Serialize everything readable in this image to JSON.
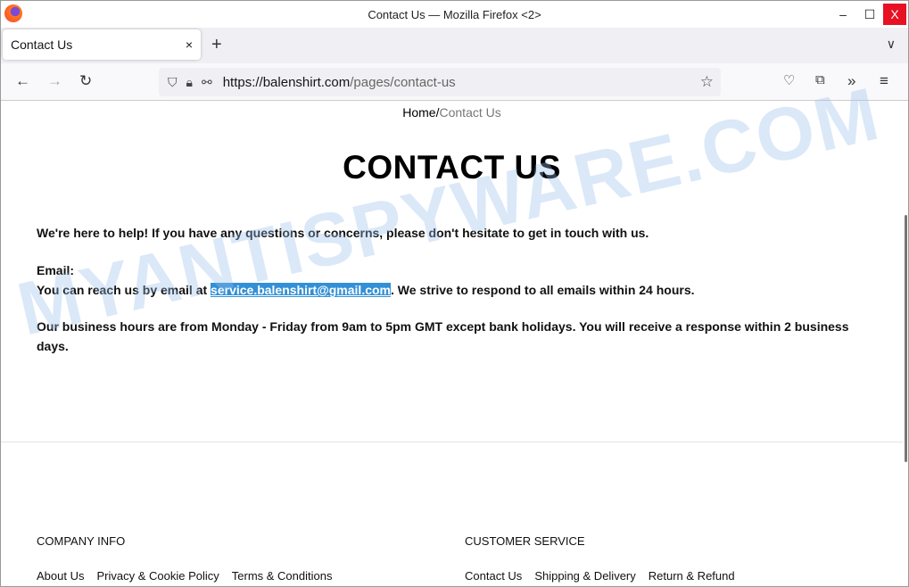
{
  "window": {
    "title": "Contact Us — Mozilla Firefox <2>",
    "minimize": "–",
    "maximize": "☐",
    "close": "X"
  },
  "tab": {
    "label": "Contact Us",
    "close": "×",
    "new_tab": "+",
    "list": "∨"
  },
  "nav": {
    "url_host": "https://balenshirt.com",
    "url_path": "/pages/contact-us"
  },
  "breadcrumb": {
    "home": "Home",
    "sep": "/",
    "current": "Contact Us"
  },
  "page": {
    "title": "CONTACT US",
    "intro": "We're here to help! If you have any questions or concerns, please don't hesitate to get in touch with us.",
    "email_label": "Email:",
    "email_pre": "You can reach us by email at ",
    "email": "service.balenshirt@gmail.com",
    "email_post": ". We strive to respond to all emails within 24 hours.",
    "hours": "Our business hours are from Monday - Friday from 9am to 5pm GMT except bank holidays. You will receive a response within 2 business days."
  },
  "footer": {
    "company": {
      "heading": "COMPANY INFO",
      "links": [
        "About Us",
        "Privacy & Cookie Policy",
        "Terms & Conditions"
      ]
    },
    "service": {
      "heading": "CUSTOMER SERVICE",
      "links": [
        "Contact Us",
        "Shipping & Delivery",
        "Return & Refund"
      ]
    }
  },
  "watermark": "MYANTISPYWARE.COM",
  "colors": {
    "selection": "#3390d6",
    "close": "#e81123"
  }
}
